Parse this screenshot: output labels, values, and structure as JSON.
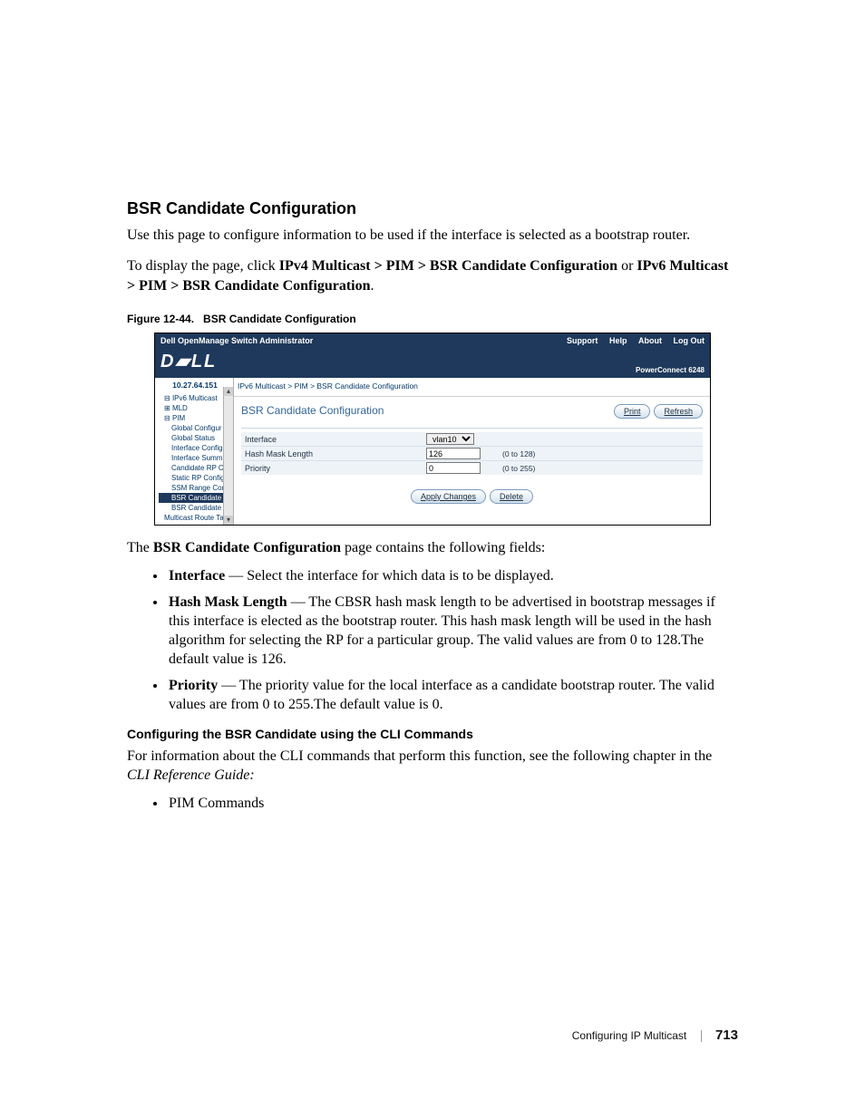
{
  "section": {
    "title": "BSR Candidate Configuration",
    "intro": "Use this page to configure information to be used if the interface is selected as a bootstrap router.",
    "nav_sentence_prefix": "To display the page, click ",
    "nav_path_a": "IPv4 Multicast > PIM > BSR Candidate Configuration",
    "nav_or": " or ",
    "nav_path_b": "IPv6 Multicast > PIM > BSR Candidate Configuration",
    "nav_period": "."
  },
  "figure": {
    "caption_prefix": "Figure 12-44.",
    "caption_title": "BSR Candidate Configuration",
    "topbar_title": "Dell OpenManage Switch Administrator",
    "topbar_links": {
      "support": "Support",
      "help": "Help",
      "about": "About",
      "logout": "Log Out"
    },
    "logo_text": "D▰LL",
    "product_label": "PowerConnect 6248",
    "ip": "10.27.64.151",
    "tree": {
      "root": "IPv6 Multicast",
      "mld": "MLD",
      "pim": "PIM",
      "items": [
        "Global Configur",
        "Global Status",
        "Interface Config",
        "Interface Summ",
        "Candidate RP C",
        "Static RP Config",
        "SSM Range Cor",
        "BSR Candidate",
        "BSR Candidate"
      ],
      "last": "Multicast Route Ta"
    },
    "breadcrumb": "IPv6 Multicast > PIM > BSR Candidate Configuration",
    "panel_title": "BSR Candidate Configuration",
    "buttons": {
      "print": "Print",
      "refresh": "Refresh",
      "apply": "Apply Changes",
      "delete": "Delete"
    },
    "form": {
      "interface_label": "Interface",
      "interface_value": "vlan10",
      "hash_label": "Hash Mask Length",
      "hash_value": "126",
      "hash_range": "(0 to 128)",
      "priority_label": "Priority",
      "priority_value": "0",
      "priority_range": "(0 to 255)"
    }
  },
  "body": {
    "page_contains_prefix": "The ",
    "page_contains_bold": "BSR Candidate Configuration",
    "page_contains_suffix": " page contains the following fields:",
    "fields": [
      {
        "term": "Interface",
        "desc": " — Select the interface for which data is to be displayed."
      },
      {
        "term": "Hash Mask Length",
        "desc": " — The CBSR hash mask length to be advertised in bootstrap messages if this interface is elected as the bootstrap router. This hash mask length will be used in the hash algorithm for selecting the RP for a particular group. The valid values are from 0 to 128.The default value is 126."
      },
      {
        "term": "Priority",
        "desc": " — The priority value for the local interface as a candidate bootstrap router. The valid values are from 0 to 255.The default value is 0."
      }
    ],
    "cli_title": "Configuring the BSR Candidate using the CLI Commands",
    "cli_para_prefix": "For information about the CLI commands that perform this function, see the following chapter in the ",
    "cli_guide": "CLI Reference Guide:",
    "cli_bullet": "PIM Commands"
  },
  "footer": {
    "chapter": "Configuring IP Multicast",
    "page": "713"
  }
}
